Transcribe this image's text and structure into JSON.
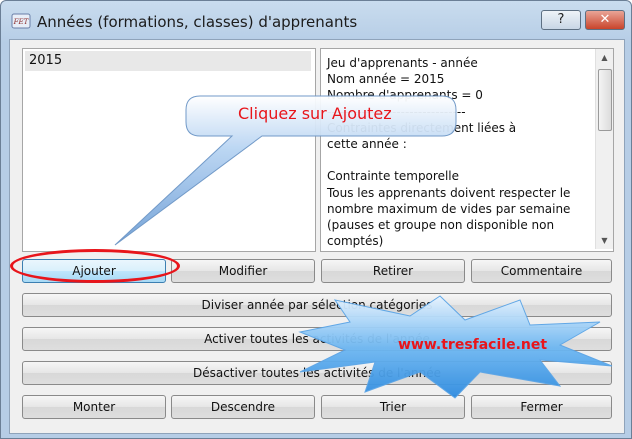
{
  "window": {
    "title": "Années (formations, classes) d'apprenants",
    "help_label": "?",
    "close_label": "✕",
    "app_icon": "fet-logo-icon"
  },
  "years_list": {
    "items": [
      {
        "label": "2015"
      }
    ]
  },
  "info": {
    "text": "Jeu d'apprenants - année\nNom année = 2015\nNombre d'apprenants = 0\n--------------------------------\nContraintes directement liées à\ncette année :\n\nContrainte temporelle\nTous les apprenants doivent respecter le\nnombre maximum de vides par semaine\n(pauses et groupe non disponible non\ncomptés)\nNombre maximum de vides"
  },
  "buttons": {
    "add": "Ajouter",
    "modify": "Modifier",
    "remove": "Retirer",
    "comment": "Commentaire",
    "divide": "Diviser année par sélection catégories",
    "activate_all": "Activer toutes les activités de l'année",
    "deactivate_all": "Désactiver toutes les activités de l'année",
    "move_up": "Monter",
    "move_down": "Descendre",
    "sort": "Trier",
    "close": "Fermer"
  },
  "annotations": {
    "callout": "Cliquez sur Ajoutez",
    "watermark": "www.tresfacile.net"
  },
  "colors": {
    "annotation_red": "#e8151b",
    "callout_blue": "#8ab8ea",
    "starburst_blue": "#4aa7ef",
    "title_gradient_top": "#c9dcee"
  }
}
